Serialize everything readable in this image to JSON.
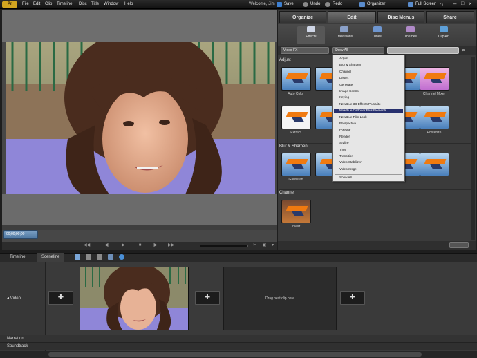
{
  "menu": [
    "File",
    "Edit",
    "Clip",
    "Timeline",
    "Disc",
    "Title",
    "Window",
    "Help"
  ],
  "user": "Welcome, Jim",
  "toolbar": {
    "save": "Save",
    "undo": "Undo",
    "redo": "Redo",
    "organizer": "Organizer",
    "fullscreen": "Full Screen"
  },
  "monitor": {
    "playhead_label": "00;00;00;00"
  },
  "tabs": {
    "organize": "Organize",
    "edit": "Edit",
    "disc_menus": "Disc Menus",
    "share": "Share"
  },
  "subtabs": {
    "effects": "Effects",
    "transitions": "Transitions",
    "titles": "Titles",
    "themes": "Themes",
    "clip_art": "Clip Art"
  },
  "filters": {
    "category": "Video FX",
    "subcategory": "Show All"
  },
  "categories": {
    "adjust": "Adjust",
    "blur_sharpen": "Blur & Sharpen",
    "channel": "Channel"
  },
  "effects": {
    "auto_color": "Auto Color",
    "other_1": "",
    "other_2": "",
    "other_3": "",
    "channel_mixer": "Channel Mixer",
    "extract": "Extract",
    "other_4": "",
    "posterize": "Posterize",
    "other_5": "",
    "other_6": "",
    "gaussian": "Gaussian",
    "other_7": "",
    "other_8": "",
    "channel_invert": "Invert"
  },
  "dropdown": {
    "items": [
      "Adjust",
      "Blur & Sharpen",
      "Channel",
      "Distort",
      "Generate",
      "Image Control",
      "Keying",
      "NewBlue 3D Effects Plus Lite",
      "NewBlue Cartoonr Plus Elements",
      "NewBlue Film Look",
      "Perspective",
      "Pixelate",
      "Render",
      "Stylize",
      "Time",
      "Transition",
      "Video Stabilizer",
      "Videomerge",
      "Show All"
    ],
    "highlighted_index": 8
  },
  "lower_tabs": {
    "timeline": "Timeline",
    "sceneline": "Sceneline"
  },
  "tracks": {
    "video": "Video",
    "narration": "Narration",
    "soundtrack": "Soundtrack"
  },
  "drop_zone_text": "Drag next clip here",
  "colors": {
    "accent": "#27306e",
    "panel": "#3b3b3b",
    "monitor": "#6e6e6e"
  }
}
